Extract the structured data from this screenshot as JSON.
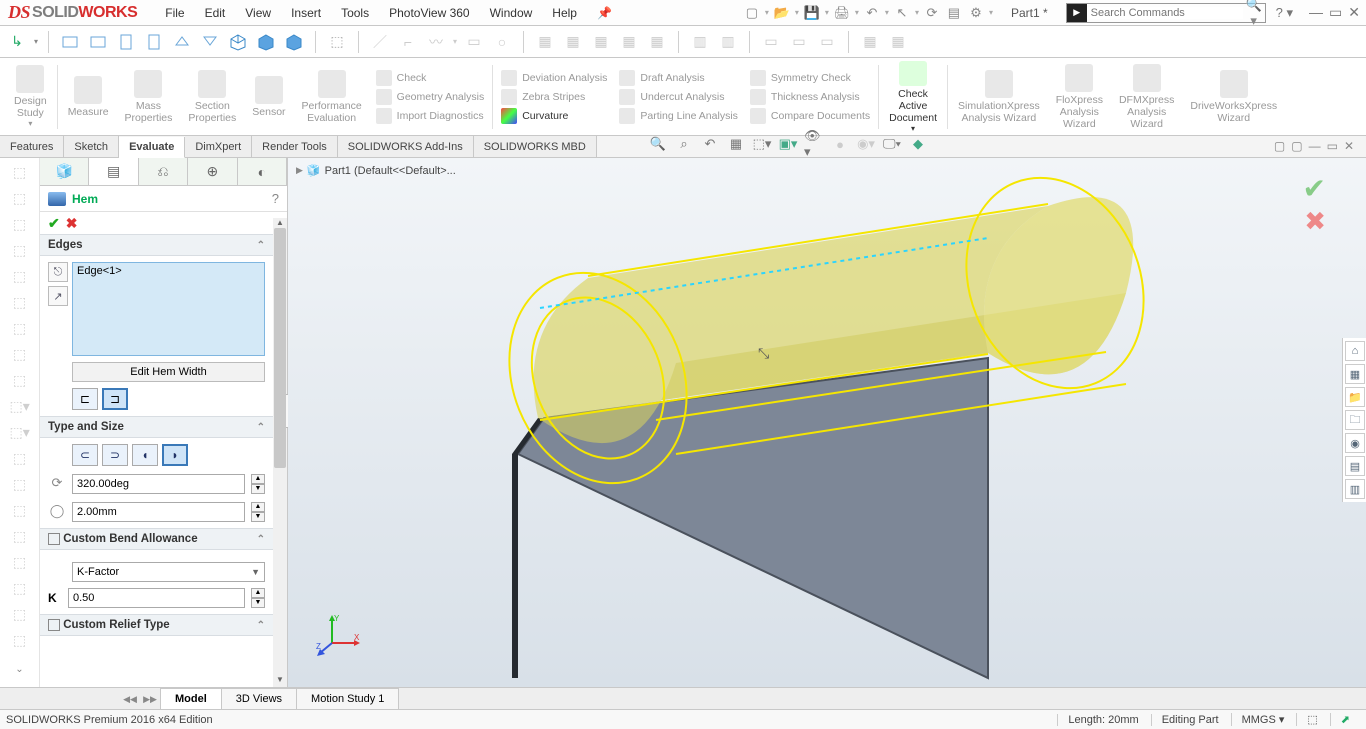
{
  "app": {
    "logo_solid": "SOLID",
    "logo_works": "WORKS",
    "menus": [
      "File",
      "Edit",
      "View",
      "Insert",
      "Tools",
      "PhotoView 360",
      "Window",
      "Help"
    ],
    "doc": "Part1 *",
    "search_placeholder": "Search Commands"
  },
  "ribbon": {
    "design_study": "Design\nStudy",
    "measure": "Measure",
    "mass": "Mass\nProperties",
    "section": "Section\nProperties",
    "sensor": "Sensor",
    "perf": "Performance\nEvaluation",
    "col_a": [
      "Check",
      "Geometry Analysis",
      "Import Diagnostics"
    ],
    "col_b": [
      "Deviation Analysis",
      "Zebra Stripes",
      "Curvature"
    ],
    "col_c": [
      "Draft Analysis",
      "Undercut Analysis",
      "Parting Line Analysis"
    ],
    "col_d": [
      "Symmetry Check",
      "Thickness Analysis",
      "Compare Documents"
    ],
    "check_doc": "Check\nActive\nDocument",
    "sim": "SimulationXpress\nAnalysis Wizard",
    "flo": "FloXpress\nAnalysis\nWizard",
    "dfm": "DFMXpress\nAnalysis\nWizard",
    "drive": "DriveWorksXpress\nWizard"
  },
  "tabs": [
    "Features",
    "Sketch",
    "Evaluate",
    "DimXpert",
    "Render Tools",
    "SOLIDWORKS Add-Ins",
    "SOLIDWORKS MBD"
  ],
  "active_tab": "Evaluate",
  "breadcrumb": "Part1  (Default<<Default>...",
  "prop": {
    "title": "Hem",
    "edges_hdr": "Edges",
    "edge_item": "Edge<1>",
    "edit_hem": "Edit Hem Width",
    "type_hdr": "Type and Size",
    "angle": "320.00deg",
    "radius": "2.00mm",
    "cba_hdr": "Custom Bend Allowance",
    "kf_label": "K-Factor",
    "k_sym": "K",
    "k_val": "0.50",
    "crt_hdr": "Custom Relief Type"
  },
  "bottom_tabs": [
    "Model",
    "3D Views",
    "Motion Study 1"
  ],
  "status": {
    "left": "SOLIDWORKS Premium 2016 x64 Edition",
    "length": "Length: 20mm",
    "mode": "Editing Part",
    "units": "MMGS"
  }
}
